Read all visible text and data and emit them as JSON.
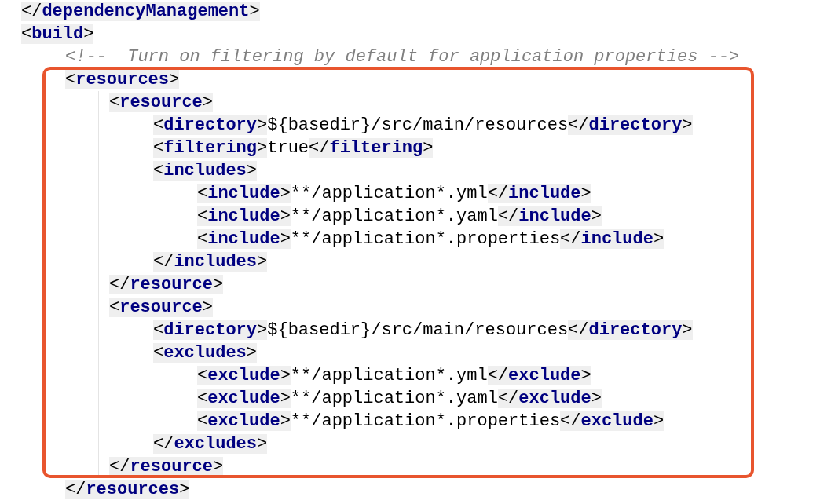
{
  "lines": [
    {
      "kind": "tag",
      "text": "</dependencyManagement>"
    },
    {
      "kind": "tag",
      "text": "<build>",
      "children": [
        {
          "kind": "comment",
          "text": "<!--  Turn on filtering by default for application properties -->"
        },
        {
          "kind": "tag",
          "text": "<resources>",
          "children": [
            {
              "kind": "tag",
              "text": "<resource>",
              "children": [
                {
                  "kind": "tag",
                  "text": "<directory>${basedir}/src/main/resources</directory>"
                },
                {
                  "kind": "tag",
                  "text": "<filtering>true</filtering>"
                },
                {
                  "kind": "tag",
                  "text": "<includes>",
                  "children": [
                    {
                      "kind": "tag",
                      "text": "<include>**/application*.yml</include>"
                    },
                    {
                      "kind": "tag",
                      "text": "<include>**/application*.yaml</include>"
                    },
                    {
                      "kind": "tag",
                      "text": "<include>**/application*.properties</include>"
                    }
                  ]
                },
                {
                  "kind": "tag",
                  "text": "</includes>"
                }
              ]
            },
            {
              "kind": "tag",
              "text": "</resource>"
            },
            {
              "kind": "tag",
              "text": "<resource>",
              "children": [
                {
                  "kind": "tag",
                  "text": "<directory>${basedir}/src/main/resources</directory>"
                },
                {
                  "kind": "tag",
                  "text": "<excludes>",
                  "children": [
                    {
                      "kind": "tag",
                      "text": "<exclude>**/application*.yml</exclude>"
                    },
                    {
                      "kind": "tag",
                      "text": "<exclude>**/application*.yaml</exclude>"
                    },
                    {
                      "kind": "tag",
                      "text": "<exclude>**/application*.properties</exclude>"
                    }
                  ]
                },
                {
                  "kind": "tag",
                  "text": "</excludes>"
                }
              ]
            },
            {
              "kind": "tag",
              "text": "</resource>"
            }
          ]
        },
        {
          "kind": "tag",
          "text": "</resources>"
        }
      ]
    }
  ]
}
